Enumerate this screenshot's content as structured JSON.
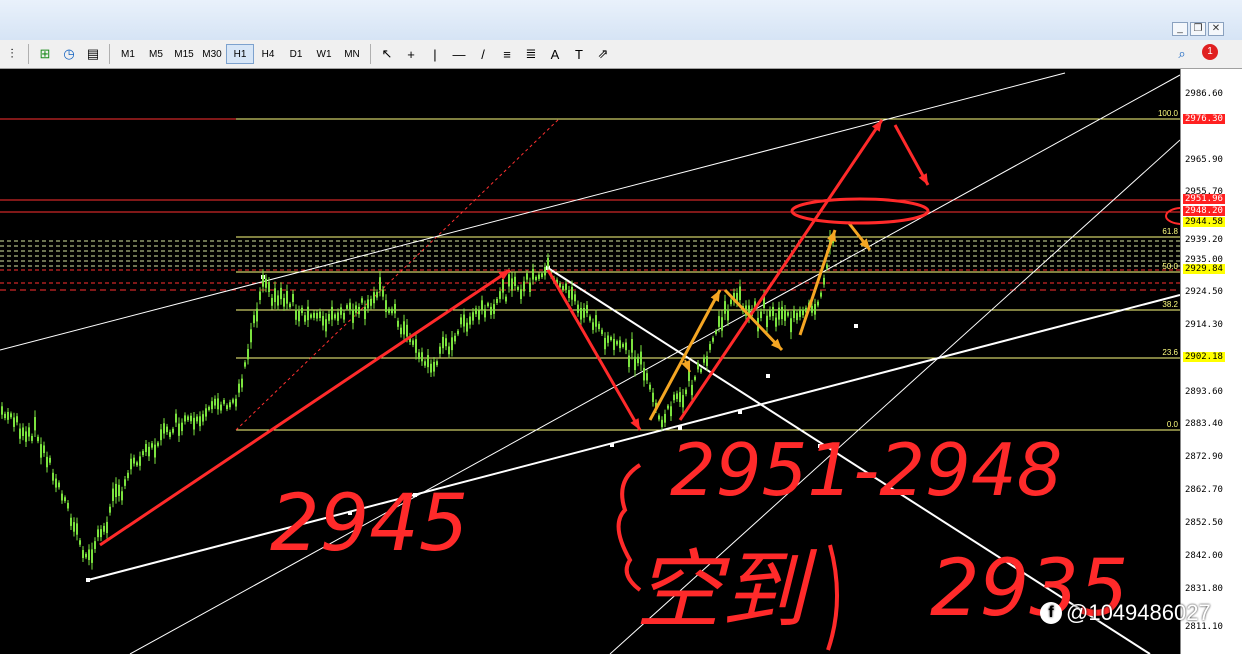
{
  "toolbar": {
    "timeframes": [
      "M1",
      "M5",
      "M15",
      "M30",
      "H1",
      "H4",
      "D1",
      "W1",
      "MN"
    ],
    "active_timeframe": "H1",
    "tools": [
      {
        "name": "cursor-icon",
        "glyph": "↖"
      },
      {
        "name": "crosshair-icon",
        "glyph": "+"
      },
      {
        "name": "vertical-line-icon",
        "glyph": "|"
      },
      {
        "name": "horizontal-line-icon",
        "glyph": "—"
      },
      {
        "name": "trendline-icon",
        "glyph": "/"
      },
      {
        "name": "channel-icon",
        "glyph": "≡"
      },
      {
        "name": "fibonacci-icon",
        "glyph": "≣"
      },
      {
        "name": "text-icon",
        "glyph": "A"
      },
      {
        "name": "text-label-icon",
        "glyph": "T"
      },
      {
        "name": "arrows-icon",
        "glyph": "⇗"
      }
    ],
    "notification_count": "1"
  },
  "price_axis": {
    "labels": [
      "2986.60",
      "2965.90",
      "2955.70",
      "2935.00",
      "2924.50",
      "2914.30",
      "2893.60",
      "2883.40",
      "2872.90",
      "2862.70",
      "2852.50",
      "2842.00",
      "2831.80",
      "2811.10"
    ],
    "tags": [
      {
        "text": "2976.30",
        "bg": "#ff2020",
        "fg": "#ffffff"
      },
      {
        "text": "2951.96",
        "bg": "#ff2020",
        "fg": "#ffffff"
      },
      {
        "text": "2948.20",
        "bg": "#ff2020",
        "fg": "#ffffff"
      },
      {
        "text": "2944.58",
        "bg": "#ffff00",
        "fg": "#000000"
      },
      {
        "text": "2939.20",
        "bg": "#ffffff",
        "fg": "#000000"
      },
      {
        "text": "2929.84",
        "bg": "#ffff00",
        "fg": "#000000"
      },
      {
        "text": "2902.18",
        "bg": "#ffff00",
        "fg": "#000000"
      }
    ]
  },
  "fibonacci_levels": [
    "100.0",
    "61.8",
    "50.0",
    "38.2",
    "23.6",
    "0.0"
  ],
  "handwriting": {
    "note1": "2945",
    "note2": "2951-2948",
    "note3": "空到",
    "note4": "2935"
  },
  "watermark": {
    "handle": "@1049486027"
  },
  "colors": {
    "candles": "#7be33f",
    "annotation_red": "#ff2a2a",
    "annotation_orange": "#f5a623",
    "channel_lines": "#ffffff",
    "fib_lines": "#ffff80"
  }
}
